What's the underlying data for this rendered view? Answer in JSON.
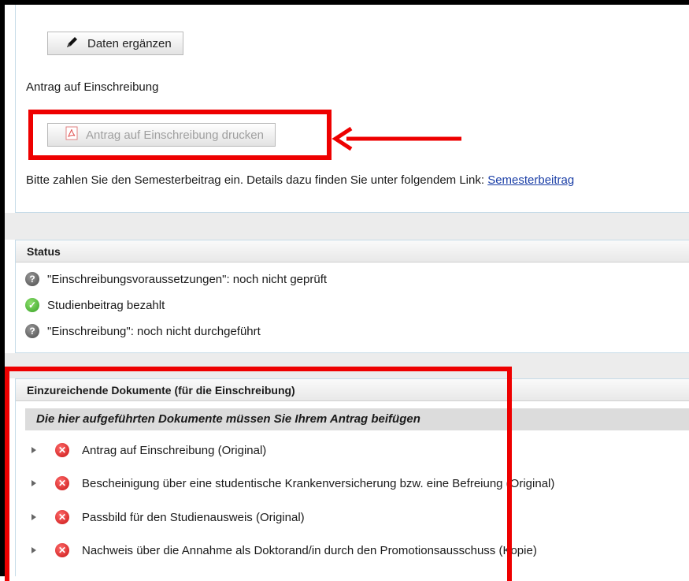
{
  "top_panel": {
    "edit_button_label": "Daten ergänzen",
    "application_label": "Antrag auf Einschreibung",
    "print_button_label": "Antrag auf Einschreibung drucken",
    "print_button_state": "disabled",
    "payment_text": "Bitte zahlen Sie den Semesterbeitrag ein. Details dazu finden Sie unter folgendem Link: ",
    "payment_link": "Semesterbeitrag"
  },
  "status_panel": {
    "header": "Status",
    "items": [
      {
        "icon": "question-icon",
        "text": "\"Einschreibungsvoraussetzungen\": noch nicht geprüft"
      },
      {
        "icon": "check-icon",
        "text": "Studienbeitrag bezahlt"
      },
      {
        "icon": "question-icon",
        "text": "\"Einschreibung\": noch nicht durchgeführt"
      }
    ]
  },
  "documents_panel": {
    "header": "Einzureichende Dokumente (für die Einschreibung)",
    "subheader": "Die hier aufgeführten Dokumente müssen Sie Ihrem Antrag beifügen",
    "items": [
      {
        "status": "missing",
        "text": "Antrag auf Einschreibung (Original)"
      },
      {
        "status": "missing",
        "text": "Bescheinigung über eine studentische Krankenversicherung bzw. eine Befreiung (Original)"
      },
      {
        "status": "missing",
        "text": "Passbild für den Studienausweis (Original)"
      },
      {
        "status": "missing",
        "text": "Nachweis über die Annahme als Doktorand/in durch den Promotionsausschuss (Kopie)"
      }
    ]
  },
  "colors": {
    "highlight": "#ee0000",
    "link": "#1a3ea6",
    "ok": "#35a023",
    "error": "#c81414"
  }
}
